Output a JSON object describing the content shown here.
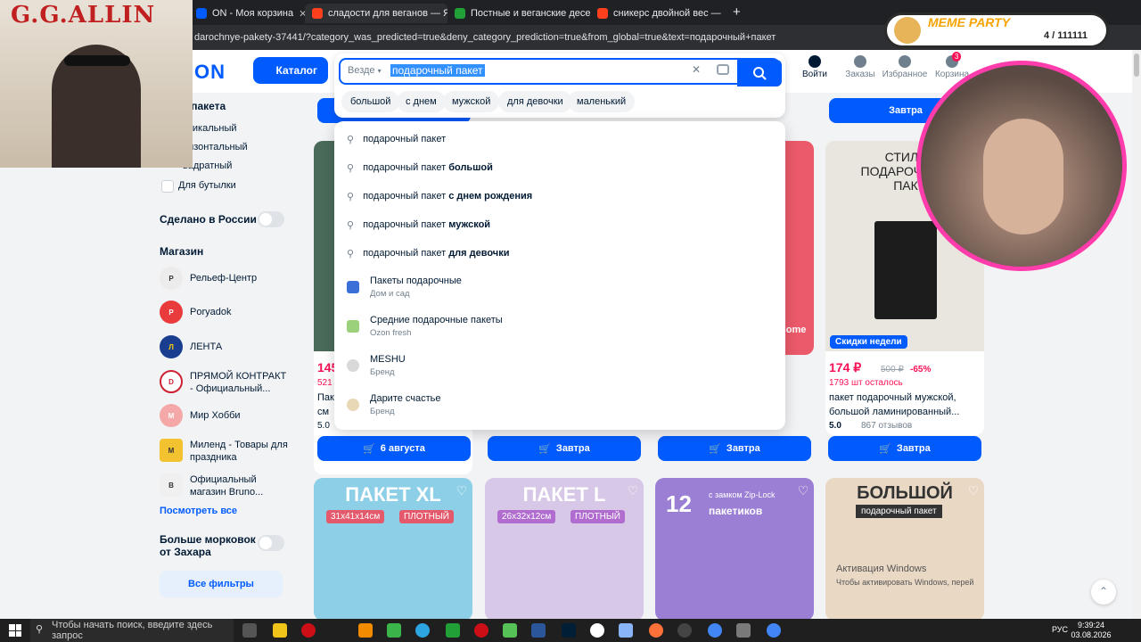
{
  "browser": {
    "tabs": [
      {
        "title": "ON - Моя корзина",
        "color": "#005bff"
      },
      {
        "title": "сладости для веганов — Янде",
        "color": "#fc3f1d"
      },
      {
        "title": "Постные и веганские десерты",
        "color": "#21a038"
      },
      {
        "title": "сникерс двойной вес — Янде",
        "color": "#fc3f1d"
      }
    ],
    "new_tab": "+",
    "address": "darochnye-pakety-37441/?category_was_predicted=true&deny_category_prediction=true&from_global=true&text=подарочный+пакет"
  },
  "header": {
    "logo": "ON",
    "catalog_label": "Каталог",
    "search": {
      "scope": "Везде",
      "query": "подарочный пакет"
    },
    "chips": [
      "большой",
      "с днем",
      "мужской",
      "для девочки",
      "маленький"
    ],
    "icons": [
      {
        "label": "Войти"
      },
      {
        "label": "Заказы"
      },
      {
        "label": "Избранное"
      },
      {
        "label": "Корзина",
        "badge": "3"
      }
    ]
  },
  "dropdown": {
    "suggestions": [
      {
        "base": "подарочный пакет",
        "bold": ""
      },
      {
        "base": "подарочный пакет",
        "bold": "большой"
      },
      {
        "base": "подарочный пакет",
        "bold": "с днем рождения"
      },
      {
        "base": "подарочный пакет",
        "bold": "мужской"
      },
      {
        "base": "подарочный пакет",
        "bold": "для девочки"
      }
    ],
    "categories": [
      {
        "title": "Пакеты подарочные",
        "sub": "Дом и сад",
        "color": "#3a6fd8"
      },
      {
        "title": "Средние подарочные пакеты",
        "sub": "Ozon fresh",
        "color": "#9ad17a"
      },
      {
        "title": "MESHU",
        "sub": "Бренд",
        "color": "#d9d9d9"
      },
      {
        "title": "Дарите счастье",
        "sub": "Бренд",
        "color": "#e9d8b5"
      }
    ]
  },
  "sidebar": {
    "section_title": "т пакета",
    "options": [
      "ртикальный",
      "ризонтальный",
      "вадратный",
      "Для бутылки"
    ],
    "made_in_russia": "Сделано в России",
    "shop_title": "Магазин",
    "shops": [
      {
        "name": "Рельеф-Центр",
        "color": "#ececec",
        "text": "#333"
      },
      {
        "name": "Poryadok",
        "color": "#e93b3b",
        "text": "#fff"
      },
      {
        "name": "ЛЕНТА",
        "color": "#1a3d8f",
        "text": "#ffd100"
      },
      {
        "name": "ПРЯМОЙ КОНТРАКТ - Официальный...",
        "color": "#fff",
        "text": "#333"
      },
      {
        "name": "Мир Хобби",
        "color": "#f4a8a8",
        "text": "#fff"
      },
      {
        "name": "Миленд - Товары для праздника",
        "color": "#f2c230",
        "text": "#333"
      },
      {
        "name": "Официальный магазин Bruno...",
        "color": "#f0f0f0",
        "text": "#333"
      }
    ],
    "see_all": "Посмотреть все",
    "carrot": "Больше морковок от Захара",
    "all_filters": "Все фильтры"
  },
  "products_row1": [
    {
      "price": "145",
      "remaining": "521 ш",
      "name": "Пак",
      "name2": "см",
      "rating": "5.0",
      "button": "6 августа",
      "img": "#4a6b5a"
    },
    {
      "price": "",
      "remaining": "",
      "name": "",
      "name2": "",
      "rating": "",
      "button": "Завтра",
      "img": "#f3d9a8"
    },
    {
      "price": "",
      "remaining": "",
      "name": "",
      "name2": "",
      "rating": "",
      "button": "Завтра",
      "img": "#eb5a6a"
    },
    {
      "price": "174 ₽",
      "old": "500 ₽",
      "discount": "-65%",
      "remaining": "1793 шт осталось",
      "name": "пакет подарочный мужской,",
      "name2": "большой ламинированный...",
      "rating": "5.0",
      "reviews": "867 отзывов",
      "button": "Завтра",
      "badge": "Скидки недели",
      "img_title": "СТИЛЬ ПОДАРОЧНЫЙ ПАК",
      "img": "#e9e5df"
    }
  ],
  "products_row1_partial_label": "home",
  "products_row2": [
    {
      "title": "ПАКЕТ XL",
      "sub1": "31x41x14см",
      "sub2": "ПЛОТНЫЙ",
      "img": "#8ecfe8"
    },
    {
      "title": "ПАКЕТ L",
      "sub1": "26x32x12см",
      "sub2": "ПЛОТНЫЙ",
      "img": "#d8c8e8"
    },
    {
      "title": "12",
      "sub1": "с замком Zip-Lock",
      "sub2": "пакетиков",
      "img": "#9b7fd4"
    },
    {
      "title": "БОЛЬШОЙ",
      "sub1": "подарочный пакет",
      "sub2": "",
      "img": "#e9d8c4"
    }
  ],
  "overlay": {
    "webcam_label": "G.G.ALLIN",
    "meme_title": "MEME PARTY",
    "meme_counter": "4 / 111111",
    "activation_title": "Активация Windows",
    "activation_sub": "Чтобы активировать Windows, перей"
  },
  "taskbar": {
    "search_placeholder": "Чтобы начать поиск, введите здесь запрос",
    "lang": "РУС",
    "time": "9:39:24",
    "date": "03.08.2026"
  }
}
